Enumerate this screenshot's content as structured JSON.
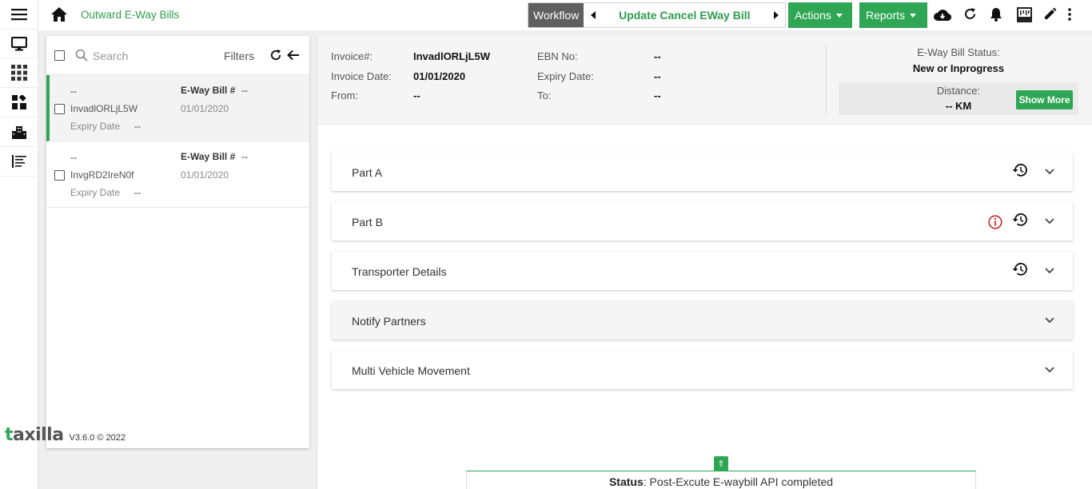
{
  "app": {
    "title": "Outward E-Way Bills"
  },
  "workflow": {
    "label": "Workflow",
    "current_step": "Update Cancel EWay Bill"
  },
  "toolbar": {
    "actions_label": "Actions",
    "reports_label": "Reports"
  },
  "list": {
    "search_placeholder": "Search",
    "filters_label": "Filters",
    "items": [
      {
        "dash": "--",
        "ewb_label": "E-Way Bill #",
        "ewb_value": "--",
        "invoice": "InvadlORLjL5W",
        "date": "01/01/2020",
        "expiry_label": "Expiry Date",
        "expiry_value": "--"
      },
      {
        "dash": "--",
        "ewb_label": "E-Way Bill #",
        "ewb_value": "--",
        "invoice": "InvgRD2IreN0f",
        "date": "01/01/2020",
        "expiry_label": "Expiry Date",
        "expiry_value": "--"
      }
    ]
  },
  "brand": {
    "name": "taxilla",
    "version": "V3.6.0 © 2022"
  },
  "summary": {
    "invoice_label": "Invoice#:",
    "invoice_value": "InvadlORLjL5W",
    "invoice_date_label": "Invoice Date:",
    "invoice_date_value": "01/01/2020",
    "from_label": "From:",
    "from_value": "--",
    "ebn_label": "EBN No:",
    "ebn_value": "--",
    "expiry_label": "Expiry Date:",
    "expiry_value": "--",
    "to_label": "To:",
    "to_value": "--",
    "status_label": "E-Way Bill Status:",
    "status_value": "New or Inprogress",
    "distance_label": "Distance:",
    "distance_value": "-- KM",
    "show_more_label": "Show More"
  },
  "sections": [
    {
      "title": "Part A"
    },
    {
      "title": "Part B"
    },
    {
      "title": "Transporter Details"
    },
    {
      "title": "Notify Partners"
    },
    {
      "title": "Multi Vehicle Movement"
    }
  ],
  "status_bar": {
    "label": "Status",
    "text": ": Post-Excute E-waybill API completed"
  },
  "colors": {
    "accent": "#2ea653",
    "workflow_bg": "#5f5f5f",
    "error": "#c62828"
  }
}
